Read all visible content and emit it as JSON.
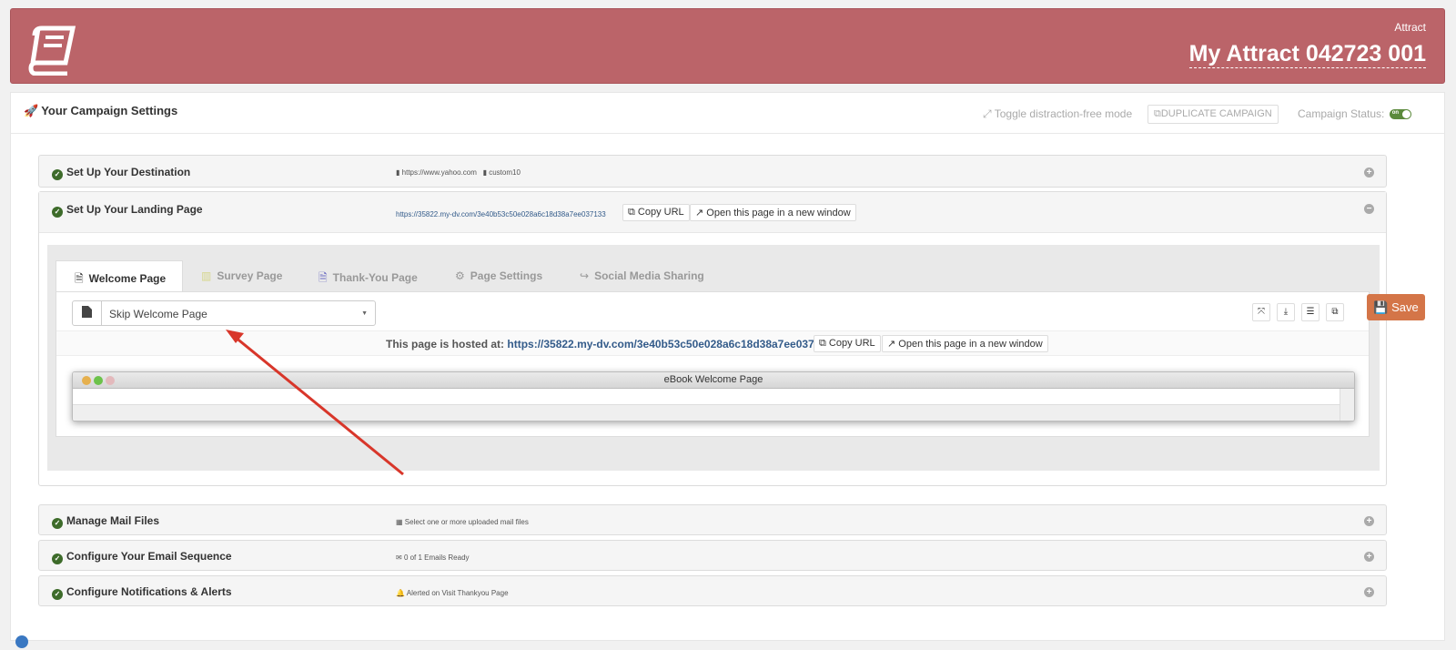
{
  "header": {
    "subtitle": "Attract",
    "title": "My Attract 042723 001",
    "logo_icon": "book-icon",
    "color": "#bb6469"
  },
  "settings_bar": {
    "title": "Your Campaign Settings",
    "toggle_label": "Toggle distraction-free mode",
    "duplicate_label": "DUPLICATE CAMPAIGN",
    "status_label": "Campaign Status:",
    "status_switch": "on"
  },
  "panels": {
    "destination": {
      "title": "Set Up Your Destination",
      "url": "https://www.yahoo.com",
      "custom": "custom10"
    },
    "landing": {
      "title": "Set Up Your Landing Page",
      "url": "https://35822.my-dv.com/3e40b53c50e028a6c18d38a7ee037133",
      "copy_url": "Copy URL",
      "open_new": "Open this page in a new window"
    },
    "mail_files": {
      "title": "Manage Mail Files",
      "info": "Select one or more uploaded mail files"
    },
    "email_seq": {
      "title": "Configure Your Email Sequence",
      "info": "0 of 1 Emails Ready"
    },
    "notifications": {
      "title": "Configure Notifications & Alerts",
      "info": "Alerted on Visit Thankyou Page"
    }
  },
  "tabs": [
    {
      "label": "Welcome Page",
      "icon": "document-icon",
      "active": true
    },
    {
      "label": "Survey Page",
      "icon": "chart-icon",
      "active": false
    },
    {
      "label": "Thank-You Page",
      "icon": "document-icon",
      "active": false
    },
    {
      "label": "Page Settings",
      "icon": "gears-icon",
      "active": false
    },
    {
      "label": "Social Media Sharing",
      "icon": "share-icon",
      "active": false
    }
  ],
  "welcome": {
    "select_value": "Skip Welcome Page",
    "hosted_label": "This page is hosted at:",
    "hosted_url": "https://35822.my-dv.com/3e40b53c50e028a6c18d38a7ee037133",
    "copy_url": "Copy URL",
    "open_new": "Open this page in a new window",
    "preview_title": "eBook Welcome Page"
  },
  "save_label": "Save",
  "colors": {
    "accent_green": "#3d6b2a",
    "save_orange": "#d47548",
    "link_blue": "#335b8a"
  }
}
